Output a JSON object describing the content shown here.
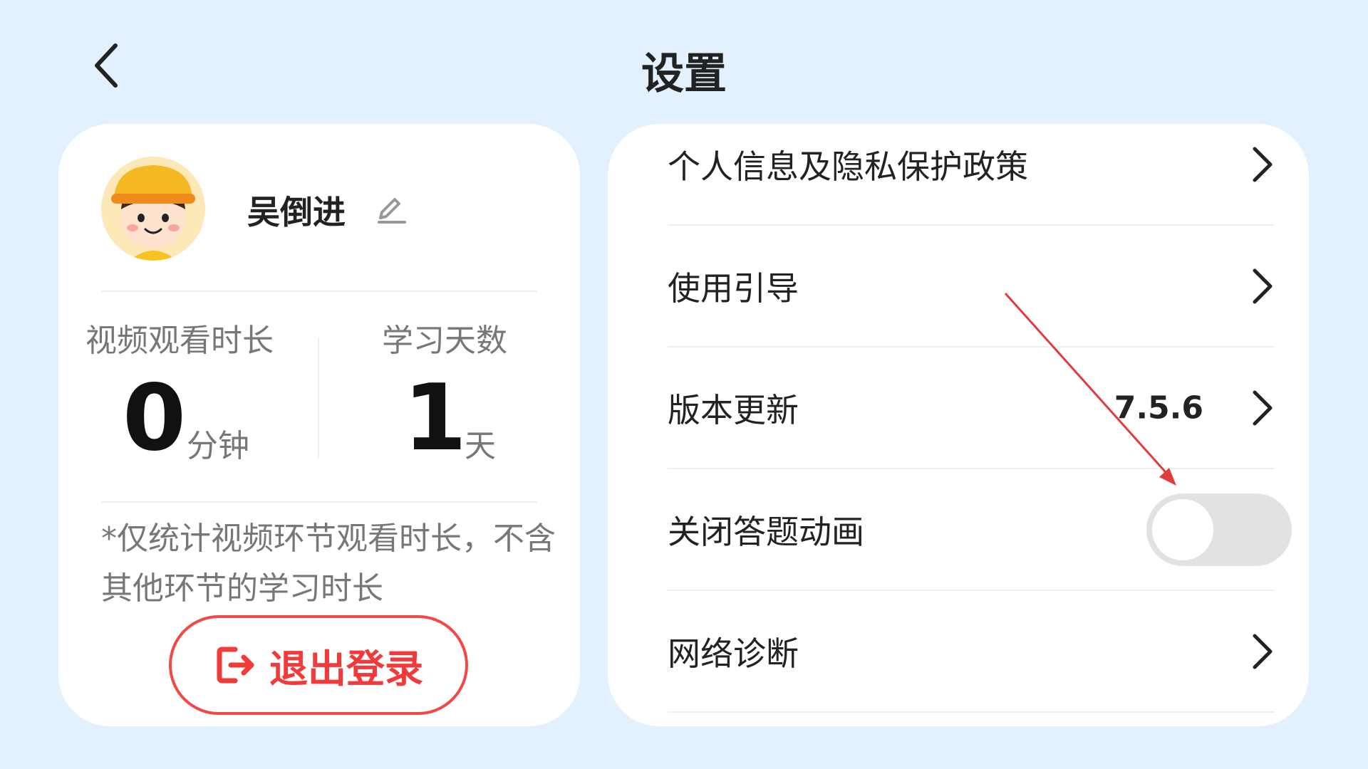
{
  "header": {
    "title": "设置"
  },
  "profile": {
    "username": "吴倒进",
    "stats": [
      {
        "label": "视频观看时长",
        "value": "0",
        "unit": "分钟"
      },
      {
        "label": "学习天数",
        "value": "1",
        "unit": "天"
      }
    ],
    "note": "*仅统计视频环节观看时长，不含其他环节的学习时长",
    "logout_label": "退出登录"
  },
  "settings": {
    "items": [
      {
        "label": "个人信息及隐私保护政策"
      },
      {
        "label": "使用引导"
      },
      {
        "label": "版本更新",
        "value": "7.5.6"
      },
      {
        "label": "关闭答题动画",
        "toggle_on": false
      },
      {
        "label": "网络诊断"
      }
    ]
  },
  "icons": {
    "back": "chevron-left-icon",
    "edit": "pencil-icon",
    "logout": "logout-icon",
    "row": "chevron-right-icon"
  },
  "colors": {
    "background": "#e3f0fd",
    "logout_accent": "#f24848",
    "toggle_off": "#e2e2e2",
    "annotation_arrow": "#e03c3c"
  }
}
